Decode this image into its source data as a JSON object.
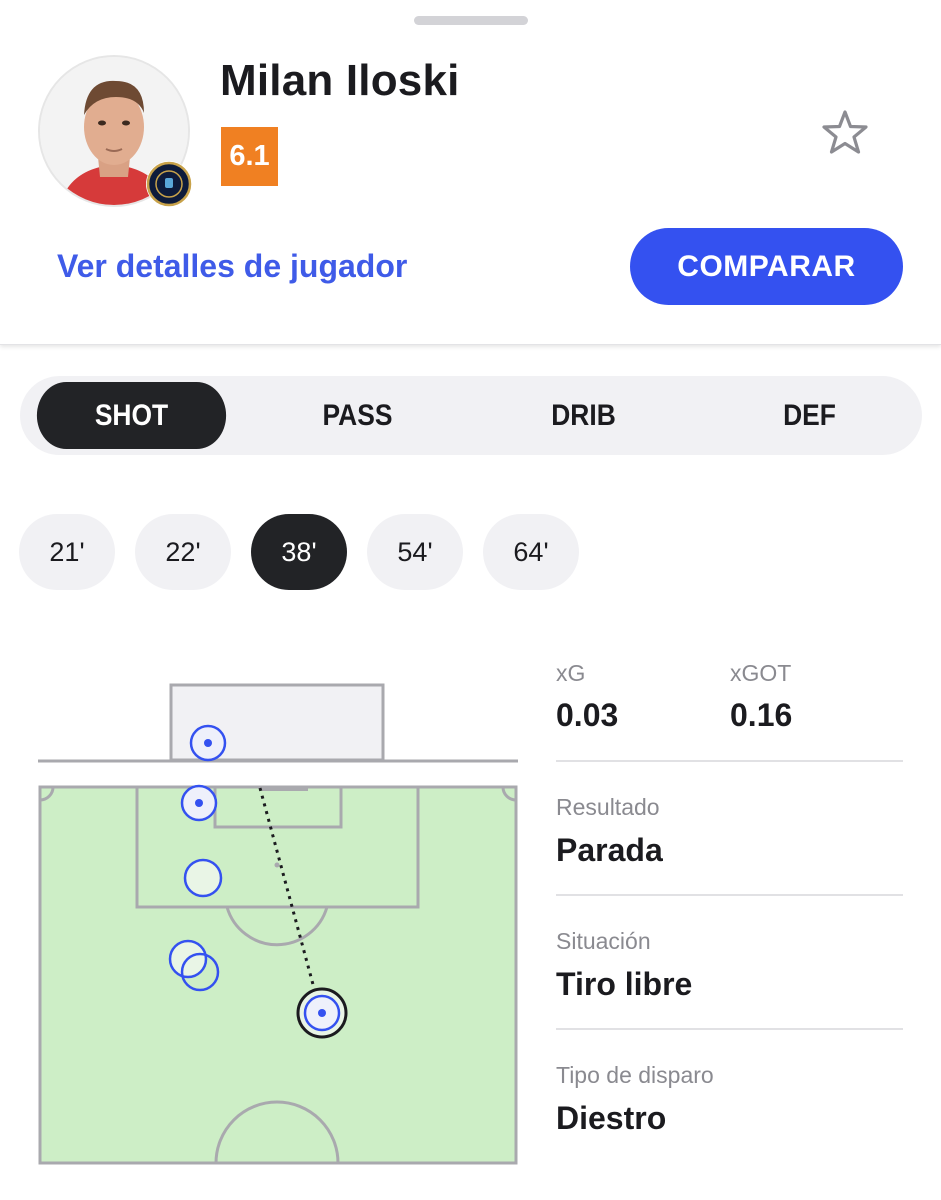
{
  "player": {
    "name": "Milan Iloski",
    "rating": "6.1",
    "details_link": "Ver detalles de jugador",
    "compare_label": "COMPARAR",
    "avatar_icon": "player-photo",
    "club_icon": "philadelphia-union-crest"
  },
  "colors": {
    "accent": "#3451f0",
    "rating_bg": "#f08022",
    "active_tab": "#222326",
    "pitch": "#cdeec6"
  },
  "tabs": [
    {
      "label": "SHOT",
      "active": true
    },
    {
      "label": "PASS",
      "active": false
    },
    {
      "label": "DRIB",
      "active": false
    },
    {
      "label": "DEF",
      "active": false
    }
  ],
  "shots": [
    {
      "label": "21'",
      "active": false
    },
    {
      "label": "22'",
      "active": false
    },
    {
      "label": "38'",
      "active": true
    },
    {
      "label": "54'",
      "active": false
    },
    {
      "label": "64'",
      "active": false
    }
  ],
  "stats": {
    "xg_label": "xG",
    "xg_value": "0.03",
    "xgot_label": "xGOT",
    "xgot_value": "0.16",
    "result_label": "Resultado",
    "result_value": "Parada",
    "situation_label": "Situación",
    "situation_value": "Tiro libre",
    "shot_type_label": "Tipo de disparo",
    "shot_type_value": "Diestro"
  }
}
